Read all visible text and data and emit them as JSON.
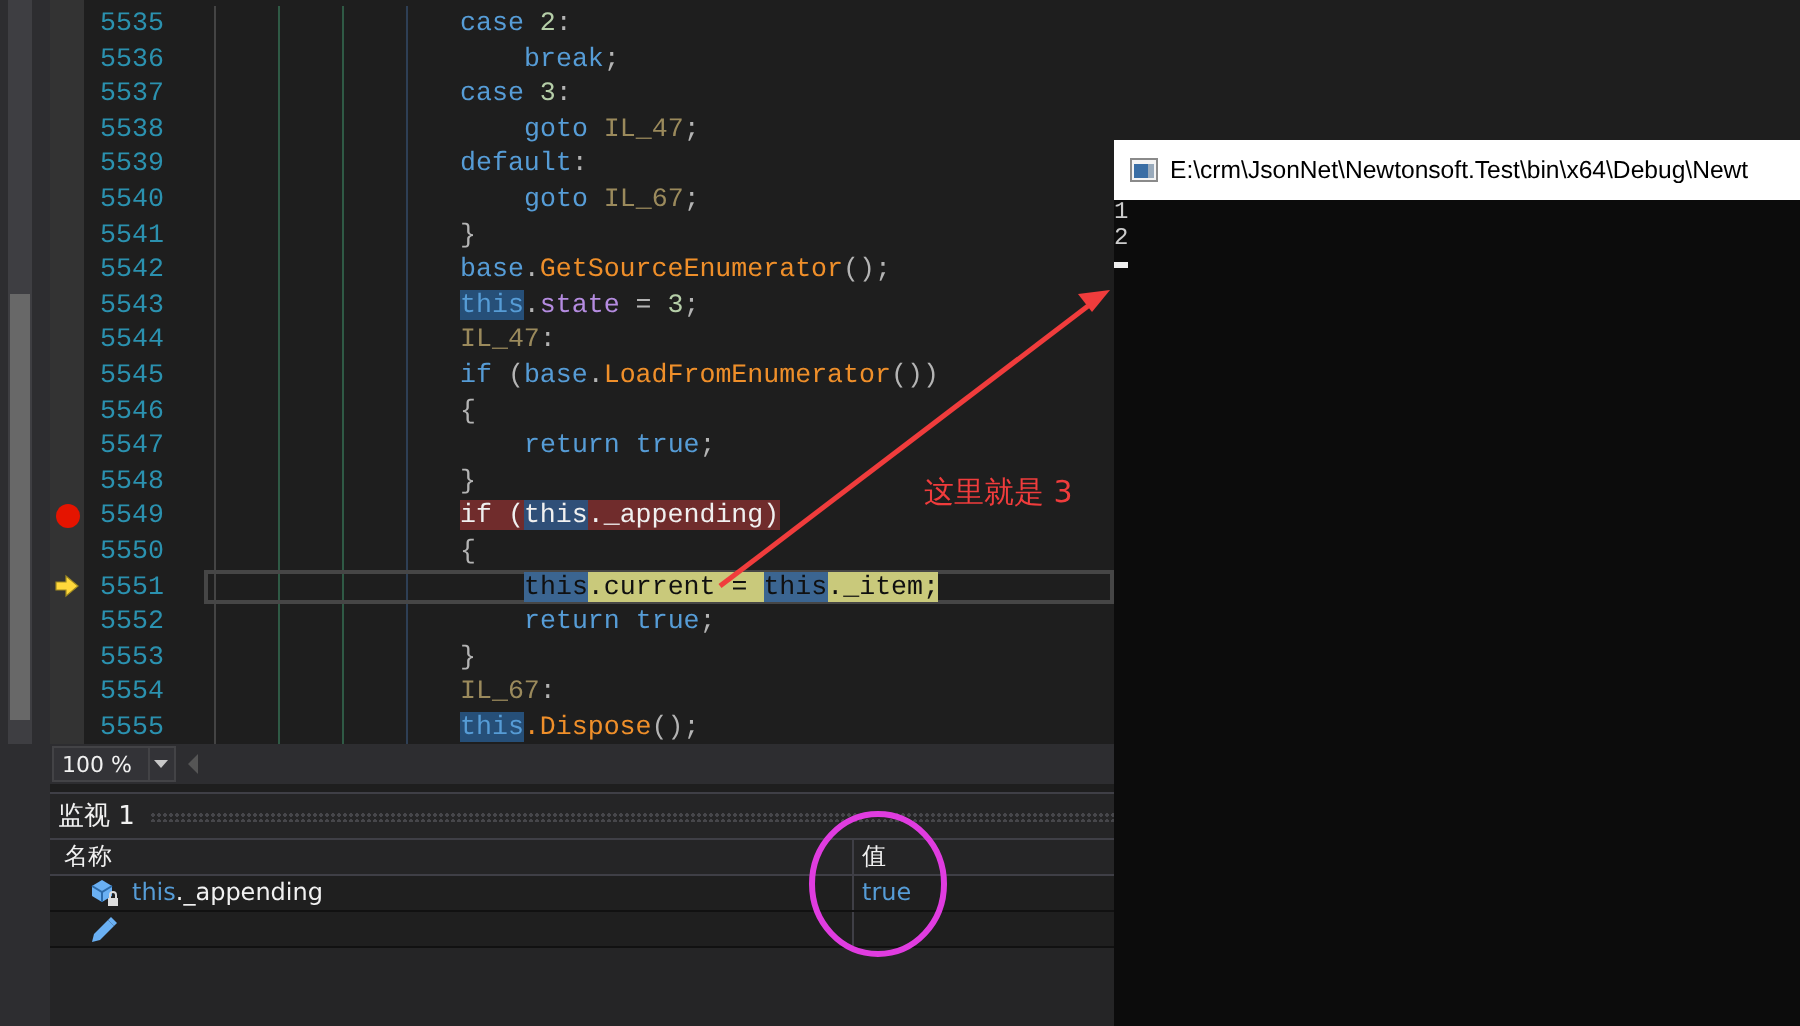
{
  "editor": {
    "lines": [
      {
        "number": "5535",
        "breakpoint": false,
        "current": false,
        "indented": false,
        "tokens": [
          {
            "kind": "keyword",
            "text": "case"
          },
          {
            "kind": "number",
            "text": " 2"
          },
          {
            "kind": "punct",
            "text": ":"
          }
        ]
      },
      {
        "number": "5536",
        "breakpoint": false,
        "current": false,
        "indented": true,
        "tokens": [
          {
            "kind": "keyword",
            "text": "break"
          },
          {
            "kind": "punct",
            "text": ";"
          }
        ]
      },
      {
        "number": "5537",
        "breakpoint": false,
        "current": false,
        "indented": false,
        "tokens": [
          {
            "kind": "keyword",
            "text": "case"
          },
          {
            "kind": "number",
            "text": " 3"
          },
          {
            "kind": "punct",
            "text": ":"
          }
        ]
      },
      {
        "number": "5538",
        "breakpoint": false,
        "current": false,
        "indented": true,
        "tokens": [
          {
            "kind": "keyword",
            "text": "goto"
          },
          {
            "kind": "label",
            "text": " IL_47"
          },
          {
            "kind": "punct",
            "text": ";"
          }
        ]
      },
      {
        "number": "5539",
        "breakpoint": false,
        "current": false,
        "indented": false,
        "tokens": [
          {
            "kind": "keyword",
            "text": "default"
          },
          {
            "kind": "punct",
            "text": ":"
          }
        ]
      },
      {
        "number": "5540",
        "breakpoint": false,
        "current": false,
        "indented": true,
        "tokens": [
          {
            "kind": "keyword",
            "text": "goto"
          },
          {
            "kind": "label",
            "text": " IL_67"
          },
          {
            "kind": "punct",
            "text": ";"
          }
        ]
      },
      {
        "number": "5541",
        "breakpoint": false,
        "current": false,
        "indented": false,
        "tokens": [
          {
            "kind": "punct",
            "text": "}"
          }
        ]
      },
      {
        "number": "5542",
        "breakpoint": false,
        "current": false,
        "indented": false,
        "tokens": [
          {
            "kind": "keyword",
            "text": "base"
          },
          {
            "kind": "punct",
            "text": "."
          },
          {
            "kind": "method",
            "text": "GetSourceEnumerator"
          },
          {
            "kind": "punct",
            "text": "();"
          }
        ]
      },
      {
        "number": "5543",
        "breakpoint": false,
        "current": false,
        "indented": false,
        "tokens": [
          {
            "kind": "reference",
            "text": "this"
          },
          {
            "kind": "punct",
            "text": "."
          },
          {
            "kind": "property",
            "text": "state"
          },
          {
            "kind": "punct",
            "text": " = "
          },
          {
            "kind": "number",
            "text": "3"
          },
          {
            "kind": "punct",
            "text": ";"
          }
        ]
      },
      {
        "number": "5544",
        "breakpoint": false,
        "current": false,
        "indented": false,
        "tokens": [
          {
            "kind": "label",
            "text": "IL_47"
          },
          {
            "kind": "punct",
            "text": ":"
          }
        ]
      },
      {
        "number": "5545",
        "breakpoint": false,
        "current": false,
        "indented": false,
        "tokens": [
          {
            "kind": "keyword",
            "text": "if"
          },
          {
            "kind": "punct",
            "text": " ("
          },
          {
            "kind": "keyword",
            "text": "base"
          },
          {
            "kind": "punct",
            "text": "."
          },
          {
            "kind": "method",
            "text": "LoadFromEnumerator"
          },
          {
            "kind": "punct",
            "text": "())"
          }
        ]
      },
      {
        "number": "5546",
        "breakpoint": false,
        "current": false,
        "indented": false,
        "tokens": [
          {
            "kind": "punct",
            "text": "{"
          }
        ]
      },
      {
        "number": "5547",
        "breakpoint": false,
        "current": false,
        "indented": true,
        "tokens": [
          {
            "kind": "keyword",
            "text": "return true"
          },
          {
            "kind": "punct",
            "text": ";"
          }
        ]
      },
      {
        "number": "5548",
        "breakpoint": false,
        "current": false,
        "indented": false,
        "tokens": [
          {
            "kind": "punct",
            "text": "}"
          }
        ]
      },
      {
        "number": "5549",
        "breakpoint": true,
        "current": false,
        "indented": false,
        "tokens": [
          {
            "kind": "keyword",
            "text": "if"
          },
          {
            "kind": "punct",
            "text": " ("
          },
          {
            "kind": "reference",
            "text": "this"
          },
          {
            "kind": "punct",
            "text": "._appending)"
          }
        ]
      },
      {
        "number": "5550",
        "breakpoint": false,
        "current": false,
        "indented": false,
        "tokens": [
          {
            "kind": "punct",
            "text": "{"
          }
        ]
      },
      {
        "number": "5551",
        "breakpoint": false,
        "current": true,
        "indented": true,
        "tokens": [
          {
            "kind": "reference",
            "text": "this"
          },
          {
            "kind": "punct",
            "text": ".current = "
          },
          {
            "kind": "reference",
            "text": "this"
          },
          {
            "kind": "punct",
            "text": "._item;"
          }
        ]
      },
      {
        "number": "5552",
        "breakpoint": false,
        "current": false,
        "indented": true,
        "tokens": [
          {
            "kind": "keyword",
            "text": "return true"
          },
          {
            "kind": "punct",
            "text": ";"
          }
        ]
      },
      {
        "number": "5553",
        "breakpoint": false,
        "current": false,
        "indented": false,
        "tokens": [
          {
            "kind": "punct",
            "text": "}"
          }
        ]
      },
      {
        "number": "5554",
        "breakpoint": false,
        "current": false,
        "indented": false,
        "tokens": [
          {
            "kind": "label",
            "text": "IL_67"
          },
          {
            "kind": "punct",
            "text": ":"
          }
        ]
      },
      {
        "number": "5555",
        "breakpoint": false,
        "current": false,
        "indented": false,
        "tokens": [
          {
            "kind": "reference",
            "text": "this"
          },
          {
            "kind": "method",
            "text": ".Dispose"
          },
          {
            "kind": "punct",
            "text": "();"
          }
        ]
      }
    ]
  },
  "zoom": {
    "value": "100 %"
  },
  "watch": {
    "title": "监视 1",
    "columns": [
      "名称",
      "值"
    ],
    "rows": [
      {
        "kind": "variable",
        "name": [
          {
            "kind": "keyword",
            "text": "this"
          },
          {
            "kind": "plain",
            "text": "._appending"
          }
        ],
        "value": "true"
      },
      {
        "kind": "add"
      }
    ]
  },
  "console": {
    "title": "E:\\crm\\JsonNet\\Newtonsoft.Test\\bin\\x64\\Debug\\Newt",
    "output": [
      "1",
      "2"
    ]
  },
  "annotations": {
    "note": "这里就是 3"
  }
}
